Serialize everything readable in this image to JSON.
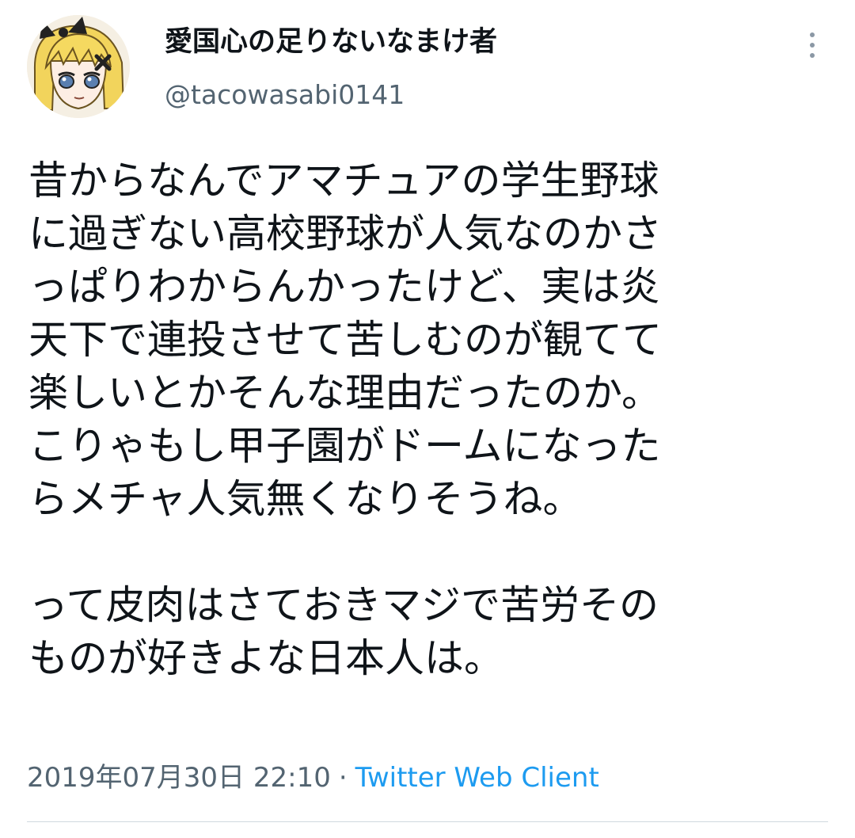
{
  "tweet": {
    "author": {
      "display_name": "愛国心の足りないなまけ者",
      "handle": "@tacowasabi0141",
      "avatar_icon": "anime-avatar-icon"
    },
    "more_icon": "more-vertical-icon",
    "text_lines": [
      "昔からなんでアマチュアの学生野球",
      "に過ぎない高校野球が人気なのかさ",
      "っぱりわからんかったけど、実は炎",
      "天下で連投させて苦しむのが観てて",
      "楽しいとかそんな理由だったのか。",
      "こりゃもし甲子園がドームになった",
      "らメチャ人気無くなりそうね。",
      "",
      "って皮肉はさておきマジで苦労その",
      "ものが好きよな日本人は。"
    ],
    "timestamp": "2019年07月30日 22:10",
    "separator": "·",
    "client": "Twitter Web Client"
  },
  "colors": {
    "text": "#0f1419",
    "secondary": "#536471",
    "link": "#1d9bf0",
    "divider": "#cfd9de"
  }
}
